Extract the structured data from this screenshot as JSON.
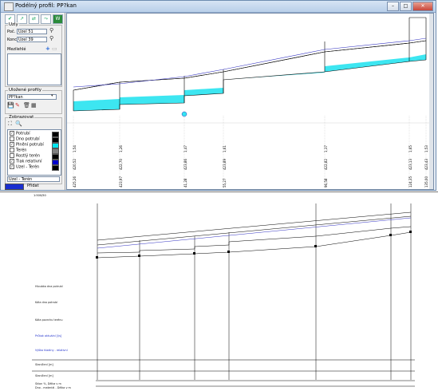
{
  "window": {
    "title": "Podélný profil: PP?kan"
  },
  "panel": {
    "uzly_label": "Uzly",
    "poc_label": "Poč.",
    "poc_value": "Uzel 51",
    "konc_label": "Konc.",
    "konc_value": "Uzel 39",
    "mezilehle_label": "Mezilehlé",
    "ulozene_label": "Uložené profily",
    "profile_value": "PP?kan",
    "zobrazovat_label": "Zobrazovat",
    "layers": [
      {
        "label": "Potrubí",
        "checked": true,
        "color": "#000000"
      },
      {
        "label": "Dno potrubí",
        "checked": false,
        "color": "#000000"
      },
      {
        "label": "Plnění potrubí",
        "checked": true,
        "color": "#00e5ee"
      },
      {
        "label": "Terén",
        "checked": false,
        "color": "#808080"
      },
      {
        "label": "Rostlý terén",
        "checked": false,
        "color": "#000000"
      },
      {
        "label": "Tlak relativní",
        "checked": true,
        "color": "#0000cc"
      },
      {
        "label": "Uzel - Terén",
        "checked": true,
        "color": "#000000"
      }
    ],
    "combo_value": "Uzel - Terén",
    "pridat_label": "Přidat"
  },
  "profile": {
    "nodes": [
      {
        "l1": "1,54",
        "l2": "420,52",
        "l3": "425,26",
        "l4": "0,00"
      },
      {
        "l1": "1,26",
        "l2": "422,70",
        "l3": "423,97",
        "l4": "10,85"
      },
      {
        "l1": "1,47",
        "l2": "423,86",
        "l3": "425,86",
        "l4": "41,28"
      },
      {
        "l1": "1,61",
        "l2": "423,89",
        "l3": "425,52",
        "l4": "55,27"
      },
      {
        "l1": "1,37",
        "l2": "422,82",
        "l3": "424,79",
        "l4": "96,58"
      },
      {
        "l1": "1,65",
        "l2": "423,13",
        "l3": "424,53",
        "l4": "124,35"
      },
      {
        "l1": "1,53",
        "l2": "423,43",
        "l3": "425,23",
        "l4": "135,00"
      }
    ]
  },
  "print": {
    "scale": "1:500/50",
    "rows": [
      "Hloubka dna potrubí",
      "Kóta dna potrubí",
      "Kóta povrchu terénu",
      "Průtok aktuální [l/s]",
      "Výška hladiny - relativní",
      "Staničení [m]",
      "Staničení [m]"
    ],
    "bottom_labels": [
      "Sklon %, Délka v m",
      "Dno - materiál - Délka v m"
    ]
  }
}
